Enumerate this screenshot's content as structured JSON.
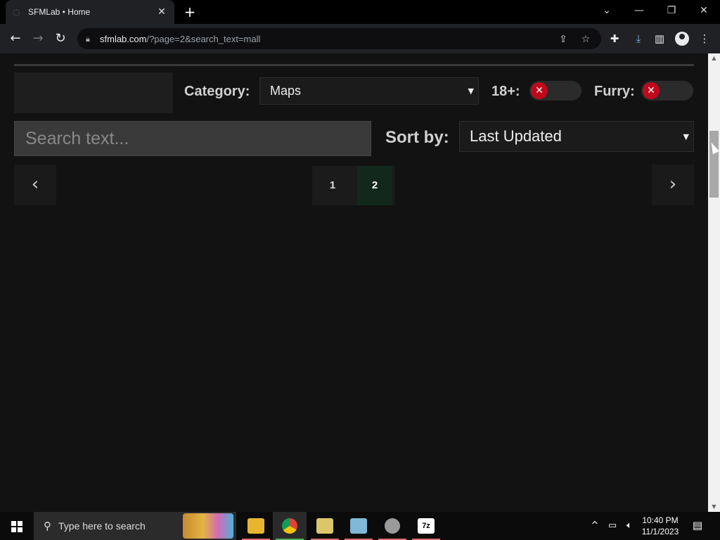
{
  "tab": {
    "title": "SFMLab • Home",
    "close": "✕"
  },
  "toolbar": {
    "url_host": "sfmlab.com",
    "url_rest": "/?page=2&search_text=mall"
  },
  "filters": {
    "category_label": "Category:",
    "category_value": "Maps",
    "adult_label": "18+:",
    "adult_toggle": "✕",
    "furry_label": "Furry:",
    "furry_toggle": "✕",
    "search_placeholder": "Search text...",
    "sort_label": "Sort by:",
    "sort_value": "Last Updated"
  },
  "pagination": {
    "prev": "‹",
    "next": "›",
    "pages": [
      "1",
      "2"
    ],
    "current": "2"
  },
  "taskbar": {
    "search_placeholder": "Type here to search",
    "time": "10:40 PM",
    "date": "11/1/2023"
  },
  "colors": {
    "toggle_knob": "#c0081c",
    "active_page": "#12281d"
  }
}
